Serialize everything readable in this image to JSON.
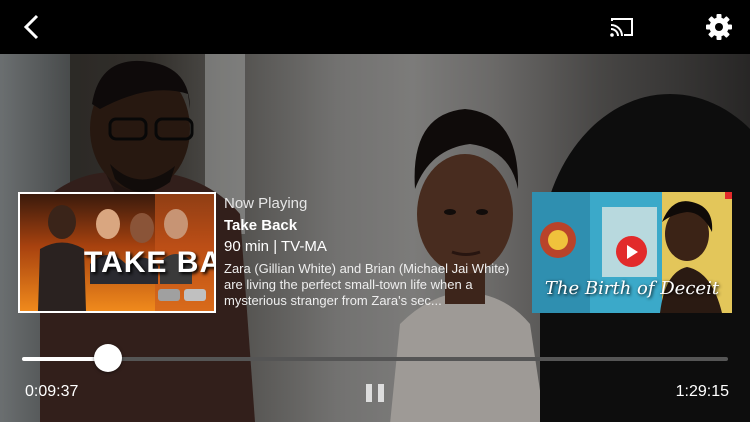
{
  "nav": {
    "back_icon": "back-chevron-icon",
    "cast_icon": "cast-icon",
    "settings_icon": "gear-icon"
  },
  "now_playing": {
    "label": "Now Playing",
    "poster_title": "TAKE BACK",
    "title": "Take Back",
    "meta": "90 min | TV-MA",
    "description": "Zara (Gillian White) and Brian (Michael Jai White) are living the perfect small-town life when a mysterious stranger from Zara's sec..."
  },
  "up_next": {
    "title": "The Birth of Deceit",
    "play_icon": "play-icon"
  },
  "playback": {
    "current_time": "0:09:37",
    "total_time": "1:29:15",
    "progress": 0.122,
    "pause_icon": "pause-icon"
  },
  "colors": {
    "accent": "#e22b2b",
    "bar_bg": "#000000"
  }
}
